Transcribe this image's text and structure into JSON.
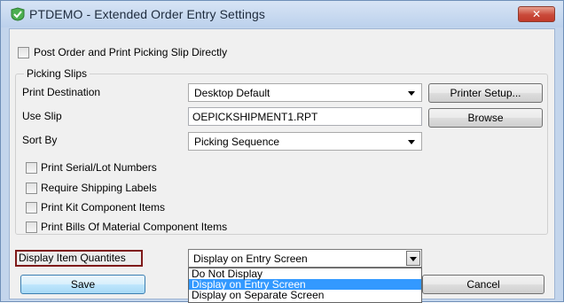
{
  "window": {
    "title": "PTDEMO - Extended Order Entry Settings",
    "close_glyph": "✕",
    "app_icon": "check-shield-icon",
    "accent": "#3399ff"
  },
  "post_order": {
    "label": "Post Order and Print Picking Slip Directly",
    "checked": false
  },
  "picking_slips": {
    "group_title": "Picking Slips",
    "print_destination": {
      "label": "Print Destination",
      "value": "Desktop Default"
    },
    "printer_setup_label": "Printer Setup...",
    "use_slip": {
      "label": "Use Slip",
      "value": "OEPICKSHIPMENT1.RPT"
    },
    "browse_label": "Browse",
    "sort_by": {
      "label": "Sort By",
      "value": "Picking Sequence"
    },
    "options": [
      {
        "label": "Print Serial/Lot Numbers",
        "checked": false
      },
      {
        "label": "Require Shipping Labels",
        "checked": false
      },
      {
        "label": "Print Kit Component Items",
        "checked": false
      },
      {
        "label": "Print Bills Of Material Component Items",
        "checked": false
      }
    ]
  },
  "display_item_quantities": {
    "label": "Display Item Quantites",
    "value": "Display on Entry Screen",
    "options": [
      "Do Not Display",
      "Display on Entry Screen",
      "Display on Separate Screen"
    ],
    "selected_index": 1
  },
  "buttons": {
    "save_label": "Save",
    "cancel_label": "Cancel"
  }
}
